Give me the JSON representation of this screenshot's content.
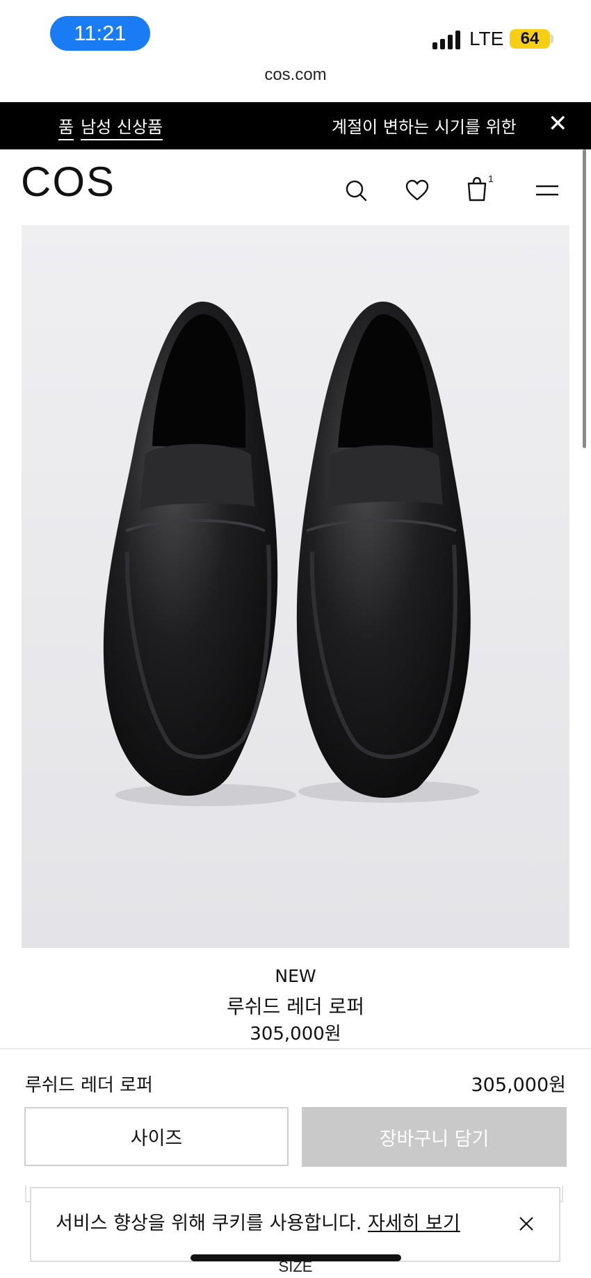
{
  "status_bar": {
    "time": "11:21",
    "network": "LTE",
    "battery": "64"
  },
  "browser": {
    "url": "cos.com"
  },
  "promo": {
    "left_links": [
      "품",
      "남성 신상품"
    ],
    "right_text": "계절이 변하는 시기를 위한",
    "close_icon": "close-icon"
  },
  "header": {
    "logo": "COS",
    "icons": [
      "search-icon",
      "heart-icon",
      "bag-icon",
      "menu-icon"
    ],
    "cart_count": "1"
  },
  "product": {
    "tag": "NEW",
    "name": "루쉬드 레더 로퍼",
    "price": "305,000원"
  },
  "sticky_bar": {
    "name": "루쉬드 레더 로퍼",
    "price": "305,000원",
    "size_label": "사이즈",
    "add_to_cart_label": "장바구니 담기",
    "add_to_cart_color": "#c9c9c9"
  },
  "cookie_banner": {
    "text": "서비스 향상을 위해 쿠키를 사용합니다.",
    "link": "자세히 보기"
  },
  "below_fold": {
    "size_label": "SIZE"
  },
  "colors": {
    "time_pill": "#1a7cf5",
    "battery": "#f6cf14",
    "promo_bg": "#000000"
  }
}
